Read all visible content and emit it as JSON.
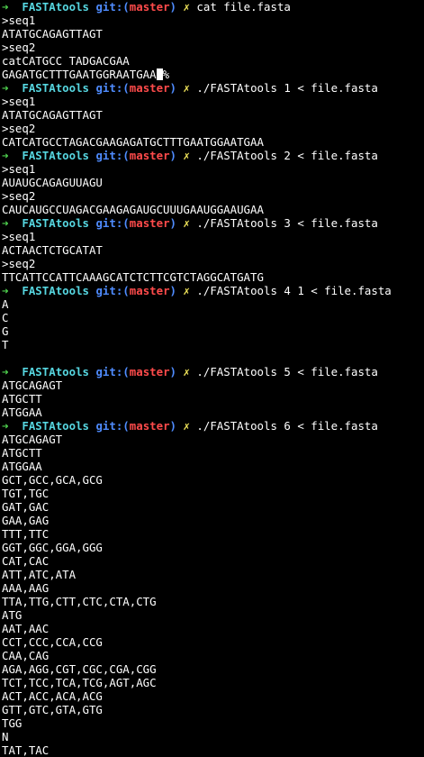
{
  "prompt": {
    "arrow": "➜",
    "dir": "FASTAtools",
    "git_prefix": "git:(",
    "branch": "master",
    "git_suffix": ")",
    "dirty_mark": "✗"
  },
  "lines": [
    {
      "type": "prompt",
      "cmd": "cat file.fasta",
      "show_arrow": false
    },
    {
      "type": "out",
      "text": ">seq1"
    },
    {
      "type": "out",
      "text": "ATATGCAGAGTTAGT"
    },
    {
      "type": "out",
      "text": ">seq2"
    },
    {
      "type": "out",
      "text": "catCATGCC TADGACGAA"
    },
    {
      "type": "out",
      "text": "GAGATGCTTTGAATGGRAATGAA",
      "suffix": "%"
    },
    {
      "type": "prompt",
      "cmd": "./FASTAtools 1 < file.fasta"
    },
    {
      "type": "out",
      "text": ">seq1"
    },
    {
      "type": "out",
      "text": "ATATGCAGAGTTAGT"
    },
    {
      "type": "out",
      "text": ">seq2"
    },
    {
      "type": "out",
      "text": "CATCATGCCTAGACGAAGAGATGCTTTGAATGGAATGAA"
    },
    {
      "type": "prompt",
      "cmd": "./FASTAtools 2 < file.fasta"
    },
    {
      "type": "out",
      "text": ">seq1"
    },
    {
      "type": "out",
      "text": "AUAUGCAGAGUUAGU"
    },
    {
      "type": "out",
      "text": ">seq2"
    },
    {
      "type": "out",
      "text": "CAUCAUGCCUAGACGAAGAGAUGCUUUGAAUGGAAUGAA"
    },
    {
      "type": "prompt",
      "cmd": "./FASTAtools 3 < file.fasta"
    },
    {
      "type": "out",
      "text": ">seq1"
    },
    {
      "type": "out",
      "text": "ACTAACTCTGCATAT"
    },
    {
      "type": "out",
      "text": ">seq2"
    },
    {
      "type": "out",
      "text": "TTCATTCCATTCAAAGCATCTCTTCGTCTAGGCATGATG"
    },
    {
      "type": "prompt",
      "cmd": "./FASTAtools 4 1 < file.fasta"
    },
    {
      "type": "out",
      "text": "A"
    },
    {
      "type": "out",
      "text": "C"
    },
    {
      "type": "out",
      "text": "G"
    },
    {
      "type": "out",
      "text": "T"
    },
    {
      "type": "out",
      "text": ""
    },
    {
      "type": "prompt",
      "cmd": "./FASTAtools 5 < file.fasta"
    },
    {
      "type": "out",
      "text": "ATGCAGAGT"
    },
    {
      "type": "out",
      "text": "ATGCTT"
    },
    {
      "type": "out",
      "text": "ATGGAA"
    },
    {
      "type": "prompt",
      "cmd": "./FASTAtools 6 < file.fasta"
    },
    {
      "type": "out",
      "text": "ATGCAGAGT"
    },
    {
      "type": "out",
      "text": "ATGCTT"
    },
    {
      "type": "out",
      "text": "ATGGAA"
    },
    {
      "type": "out",
      "text": "GCT,GCC,GCA,GCG"
    },
    {
      "type": "out",
      "text": "TGT,TGC"
    },
    {
      "type": "out",
      "text": "GAT,GAC"
    },
    {
      "type": "out",
      "text": "GAA,GAG"
    },
    {
      "type": "out",
      "text": "TTT,TTC"
    },
    {
      "type": "out",
      "text": "GGT,GGC,GGA,GGG"
    },
    {
      "type": "out",
      "text": "CAT,CAC"
    },
    {
      "type": "out",
      "text": "ATT,ATC,ATA"
    },
    {
      "type": "out",
      "text": "AAA,AAG"
    },
    {
      "type": "out",
      "text": "TTA,TTG,CTT,CTC,CTA,CTG"
    },
    {
      "type": "out",
      "text": "ATG"
    },
    {
      "type": "out",
      "text": "AAT,AAC"
    },
    {
      "type": "out",
      "text": "CCT,CCC,CCA,CCG"
    },
    {
      "type": "out",
      "text": "CAA,CAG"
    },
    {
      "type": "out",
      "text": "AGA,AGG,CGT,CGC,CGA,CGG"
    },
    {
      "type": "out",
      "text": "TCT,TCC,TCA,TCG,AGT,AGC"
    },
    {
      "type": "out",
      "text": "ACT,ACC,ACA,ACG"
    },
    {
      "type": "out",
      "text": "GTT,GTC,GTA,GTG"
    },
    {
      "type": "out",
      "text": "TGG"
    },
    {
      "type": "out",
      "text": "N"
    },
    {
      "type": "out",
      "text": "TAT,TAC"
    }
  ]
}
